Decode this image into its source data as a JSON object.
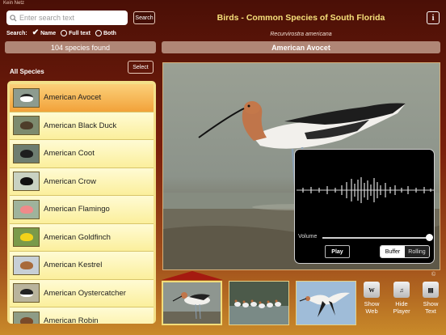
{
  "status": {
    "carrier": "Kein Netz"
  },
  "search": {
    "placeholder": "Enter search text",
    "button": "Search",
    "label": "Search:",
    "options": [
      "Name",
      "Full text",
      "Both"
    ],
    "selected_option": "Name"
  },
  "results": {
    "count_text": "104 species found"
  },
  "list": {
    "heading": "All Species",
    "select_button": "Select",
    "selected": "American Avocet",
    "items": [
      "American Avocet",
      "American Black Duck",
      "American Coot",
      "American Crow",
      "American Flamingo",
      "American Goldfinch",
      "American Kestrel",
      "American Oystercatcher",
      "American Robin"
    ]
  },
  "header": {
    "title": "Birds - Common Species of South Florida",
    "info_button": "i",
    "scientific_name": "Recurvirostra americana",
    "common_name": "American Avocet"
  },
  "player": {
    "volume_label": "Volume",
    "volume_level": 1.0,
    "play_label": "Play",
    "modes": [
      "Buffer",
      "Rolling"
    ],
    "active_mode": "Buffer"
  },
  "photo": {
    "copyright_symbol": "©"
  },
  "toolbar": {
    "show_web": "Show\nWeb",
    "hide_player": "Hide\nPlayer",
    "show_text": "Show\nText"
  },
  "colors": {
    "title": "#f6e07a",
    "list_bg": "#f3e08a",
    "selected_row": "#f2a23a",
    "accent_arrow": "#a51a10"
  }
}
